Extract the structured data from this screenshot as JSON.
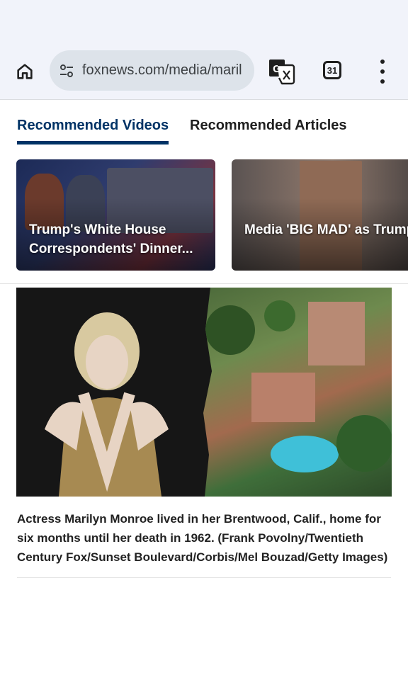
{
  "browser": {
    "url": "foxnews.com/media/maril",
    "tab_count": "31",
    "icons": [
      "home-icon",
      "site-settings-icon",
      "translate-icon",
      "tab-switcher-icon",
      "more-vert-icon"
    ]
  },
  "recommended": {
    "tabs": [
      {
        "label": "Recommended Videos",
        "active": true
      },
      {
        "label": "Recommended Articles",
        "active": false
      }
    ],
    "videos": [
      {
        "title": "Trump's White House Correspondents' Dinner..."
      },
      {
        "title": "Media 'BIG MAD' as Trump RETURNS to WH..."
      }
    ]
  },
  "article": {
    "image_caption": "Actress Marilyn Monroe lived in her Brentwood, Calif., home for six months until her death in 1962. (Frank Povolny/Twentieth Century Fox/Sunset Boulevard/Corbis/Mel Bouzad/Getty Images)"
  },
  "colors": {
    "active_tab": "#003366",
    "toolbar_bg": "#f1f3fa",
    "omnibox_bg": "#dde3ea"
  }
}
